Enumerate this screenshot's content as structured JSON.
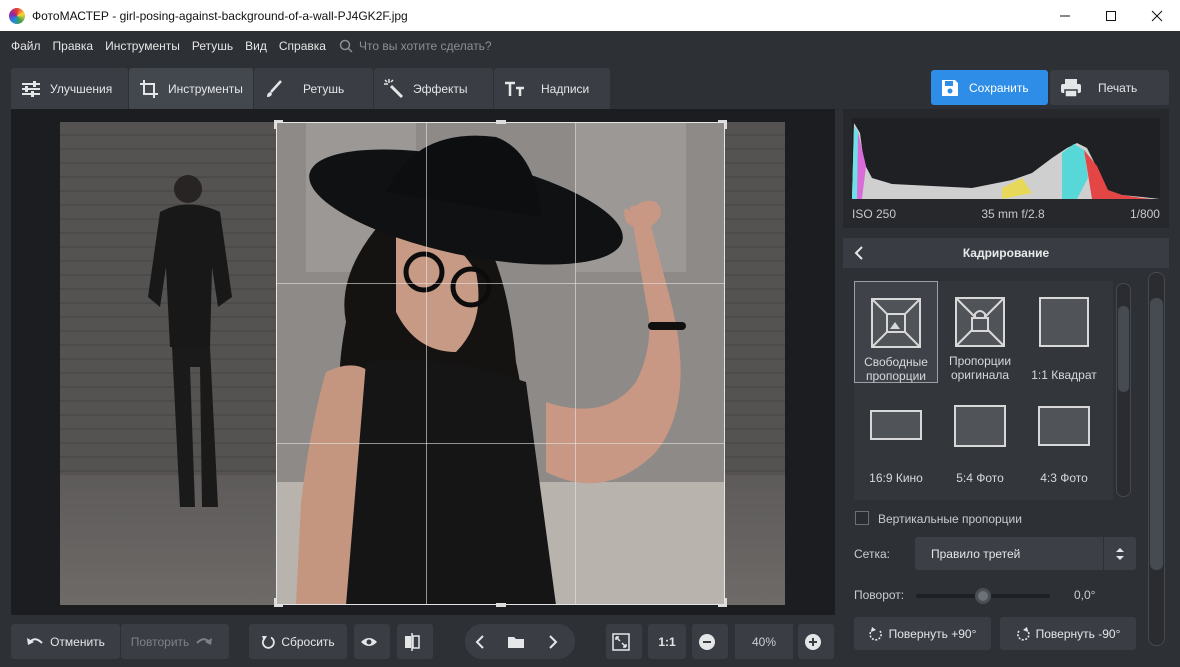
{
  "window": {
    "title": "ФотоМАСТЕР - girl-posing-against-background-of-a-wall-PJ4GK2F.jpg",
    "controls": [
      "minimize-icon",
      "maximize-icon",
      "close-icon"
    ]
  },
  "menu": {
    "items": [
      "Файл",
      "Правка",
      "Инструменты",
      "Ретушь",
      "Вид",
      "Справка"
    ],
    "search_placeholder": "Что вы хотите сделать?"
  },
  "tabs": [
    {
      "label": "Улучшения",
      "icon": "sliders-icon"
    },
    {
      "label": "Инструменты",
      "icon": "crop-icon",
      "active": true
    },
    {
      "label": "Ретушь",
      "icon": "brush-icon"
    },
    {
      "label": "Эффекты",
      "icon": "magic-wand-icon"
    },
    {
      "label": "Надписи",
      "icon": "text-icon"
    }
  ],
  "actions": {
    "save": "Сохранить",
    "print": "Печать"
  },
  "histogram": {
    "iso": "ISO 250",
    "lens": "35 mm f/2.8",
    "shutter": "1/800"
  },
  "panel": {
    "title": "Кадрирование",
    "presets": [
      {
        "label_line1": "Свободные",
        "label_line2": "пропорции",
        "selected": true
      },
      {
        "label_line1": "Пропорции",
        "label_line2": "оригинала"
      },
      {
        "label_line1": "1:1 Квадрат",
        "label_line2": ""
      },
      {
        "label_line1": "16:9 Кино",
        "label_line2": ""
      },
      {
        "label_line1": "5:4 Фото",
        "label_line2": ""
      },
      {
        "label_line1": "4:3 Фото",
        "label_line2": ""
      }
    ],
    "vertical_label": "Вертикальные пропорции",
    "vertical_checked": false,
    "grid_label": "Сетка:",
    "grid_value": "Правило третей",
    "rotation_label": "Поворот:",
    "rotation_value": "0,0°",
    "rotate_plus": "Повернуть +90°",
    "rotate_minus": "Повернуть -90°"
  },
  "bottom": {
    "undo": "Отменить",
    "redo": "Повторить",
    "reset": "Сбросить",
    "ratio": "1:1",
    "zoom": "40%"
  },
  "colors": {
    "accent": "#2e8de6",
    "background": "#2d3035"
  }
}
